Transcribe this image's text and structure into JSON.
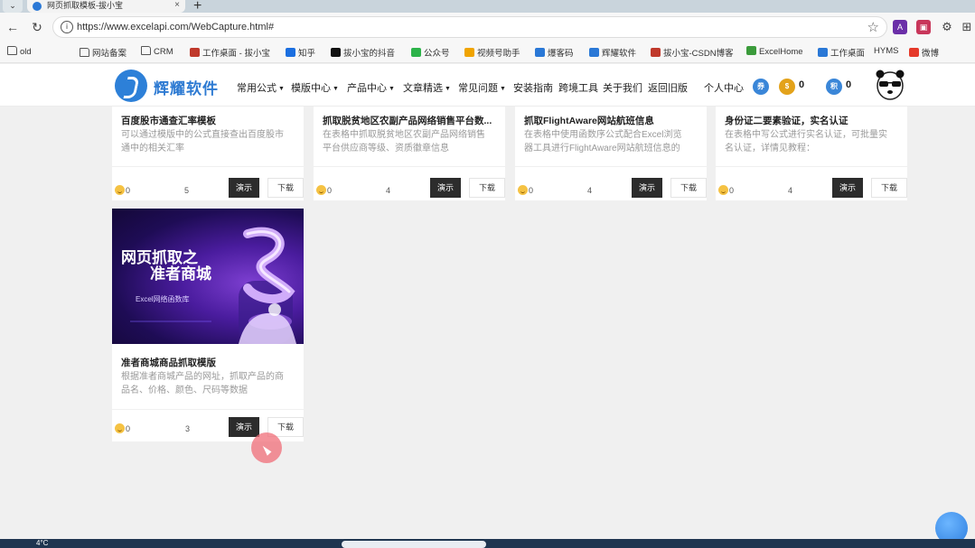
{
  "browser": {
    "tab_title": "网页抓取模板-拔小宝",
    "url": "https://www.excelapi.com/WebCapture.html#",
    "new_tab": "+",
    "close": "×"
  },
  "bookmarks": [
    {
      "label": "old",
      "kind": "folder"
    },
    {
      "label": "网站备案",
      "kind": "folder"
    },
    {
      "label": "CRM",
      "kind": "folder"
    },
    {
      "label": "工作桌面 - 拔小宝",
      "kind": "app",
      "color": "#c0392b"
    },
    {
      "label": "知乎",
      "kind": "app",
      "color": "#1b6fe0"
    },
    {
      "label": "拔小宝的抖音",
      "kind": "app",
      "color": "#111111"
    },
    {
      "label": "公众号",
      "kind": "app",
      "color": "#2db34a"
    },
    {
      "label": "视频号助手",
      "kind": "app",
      "color": "#f0a400"
    },
    {
      "label": "爆客码",
      "kind": "app",
      "color": "#2a78d6"
    },
    {
      "label": "辉耀软件",
      "kind": "app",
      "color": "#2a78d6"
    },
    {
      "label": "拔小宝-CSDN博客",
      "kind": "app",
      "color": "#c0392b"
    },
    {
      "label": "ExcelHome",
      "kind": "app",
      "color": "#3b9b3b"
    },
    {
      "label": "工作桌面",
      "kind": "app",
      "color": "#2a78d6"
    },
    {
      "label": "HYMS",
      "kind": "text"
    },
    {
      "label": "微博",
      "kind": "app",
      "color": "#e5392a"
    }
  ],
  "site": {
    "logo_text": "辉耀软件",
    "menu": [
      {
        "label": "常用公式",
        "caret": true
      },
      {
        "label": "模版中心",
        "caret": true
      },
      {
        "label": "产品中心",
        "caret": true
      },
      {
        "label": "文章精选",
        "caret": true
      },
      {
        "label": "常见问题",
        "caret": true
      },
      {
        "label": "安装指南",
        "caret": false
      },
      {
        "label": "跨境工具",
        "caret": false
      },
      {
        "label": "关于我们",
        "caret": false
      },
      {
        "label": "返回旧版",
        "caret": false
      }
    ],
    "personal_center": "个人中心",
    "badges": [
      {
        "glyph": "券",
        "color": "#3a86d8",
        "count": ""
      },
      {
        "glyph": "$",
        "color": "#e3a21a",
        "count": "0"
      },
      {
        "glyph": "积",
        "color": "#3a86d8",
        "count": "0"
      }
    ]
  },
  "cards_row1": [
    {
      "title": "百度股市通查汇率模板",
      "desc": "可以通过模版中的公式直接查出百度股市通中的相关汇率",
      "likes": "0",
      "views": "5"
    },
    {
      "title": "抓取脱贫地区农副产品网络销售平台数...",
      "desc": "在表格中抓取脱贫地区农副产品网络销售平台供应商等级、资质徽章信息",
      "likes": "0",
      "views": "4"
    },
    {
      "title": "抓取FlightAware网站航班信息",
      "desc": "在表格中使用函数序公式配合Excel浏览器工具进行FlightAware网站航班信息的",
      "likes": "0",
      "views": "4"
    },
    {
      "title": "身份证二要素验证，实名认证",
      "desc": "在表格中写公式进行实名认证，可批量实名认证，详情见教程：",
      "likes": "0",
      "views": "4"
    }
  ],
  "card_row2": {
    "thumb_line1": "网页抓取之",
    "thumb_line2": "准者商城",
    "thumb_caption": "Excel网络函数库",
    "title": "准者商城商品抓取模版",
    "desc": "根据准者商城产品的网址，抓取产品的商品名、价格、颜色、尺码等数据",
    "likes": "0",
    "views": "3"
  },
  "buttons": {
    "demo": "演示",
    "download": "下载"
  },
  "taskbar": {
    "temp": "4°C"
  }
}
